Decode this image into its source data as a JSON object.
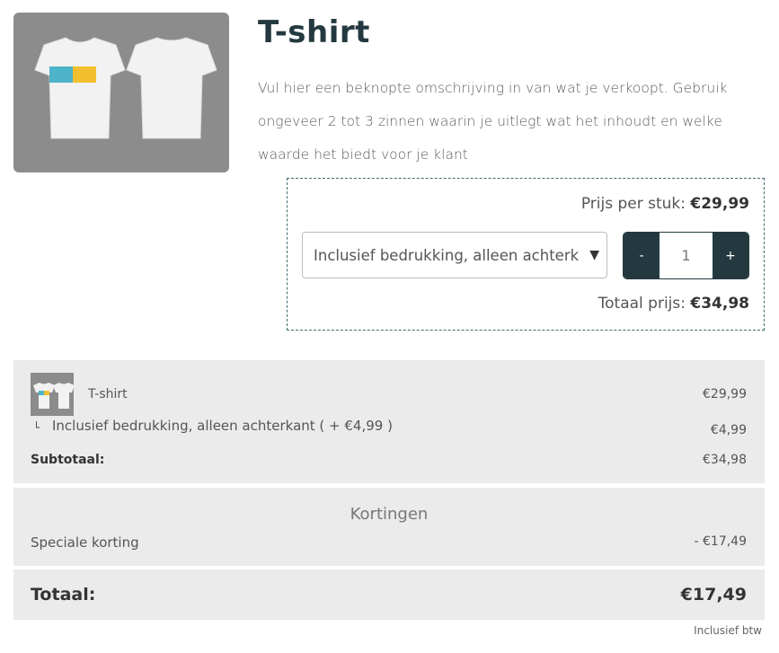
{
  "product": {
    "title": "T-shirt",
    "description": "Vul hier een beknopte omschrijving in van wat je verkoopt. Gebruik ongeveer 2 tot 3 zinnen waarin je uitlegt wat het inhoudt en welke waarde het biedt voor je klant",
    "image_icon": "tshirt-image"
  },
  "order": {
    "unit_price_label": "Prijs per stuk:",
    "unit_price_value": "€29,99",
    "option_selected": "Inclusief bedrukking, alleen achterkant",
    "quantity_minus": "-",
    "quantity_value": "1",
    "quantity_plus": "+",
    "total_label": "Totaal prijs:",
    "total_value": "€34,98"
  },
  "summary": {
    "line_name": "T-shirt",
    "line_price": "€29,99",
    "option_arrow": "└",
    "option_name": "Inclusief bedrukking, alleen achterkant ( + €4,99 )",
    "option_price": "€4,99",
    "subtotal_label": "Subtotaal:",
    "subtotal_value": "€34,98"
  },
  "discounts": {
    "heading": "Kortingen",
    "name": "Speciale korting",
    "value": "- €17,49"
  },
  "grand_total": {
    "label": "Totaal:",
    "value": "€17,49",
    "vat_note": "Inclusief btw"
  },
  "colors": {
    "accent": "#24393f",
    "panel": "#ebebeb",
    "dashed_border": "#3e6a6e"
  }
}
